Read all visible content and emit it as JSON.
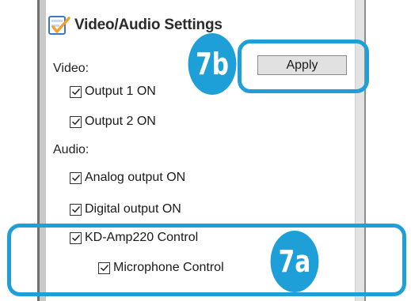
{
  "panel": {
    "title": "Video/Audio Settings",
    "icon": "settings-check-icon",
    "apply_label": "Apply"
  },
  "video": {
    "label": "Video:",
    "items": [
      {
        "label": "Output 1 ON",
        "checked": true
      },
      {
        "label": "Output 2 ON",
        "checked": true
      }
    ]
  },
  "audio": {
    "label": "Audio:",
    "items": [
      {
        "label": "Analog output ON",
        "checked": true
      },
      {
        "label": "Digital output ON",
        "checked": true
      },
      {
        "label": "KD-Amp220 Control",
        "checked": true
      },
      {
        "label": "Microphone Control",
        "checked": true
      }
    ]
  },
  "callouts": [
    {
      "label": "7b",
      "color": "#1f9fd8"
    },
    {
      "label": "7a",
      "color": "#1f9fd8"
    }
  ]
}
